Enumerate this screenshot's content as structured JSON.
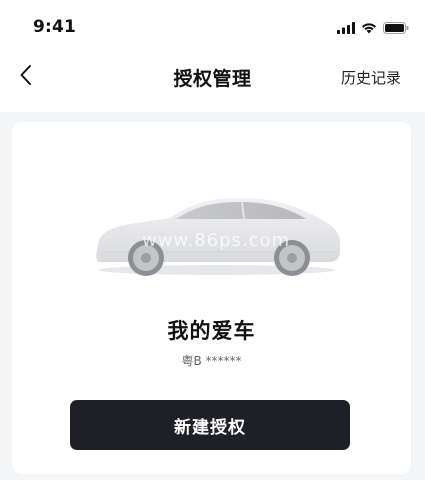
{
  "status_bar": {
    "time": "9:41",
    "icons": [
      "signal-icon",
      "wifi-icon",
      "battery-icon"
    ]
  },
  "nav": {
    "back_icon": "chevron-left-icon",
    "title": "授权管理",
    "history_label": "历史记录"
  },
  "card": {
    "car_image": "car-side-view",
    "watermark": "www.86ps.com",
    "car_name": "我的爱车",
    "plate": "粤B ******",
    "button_label": "新建授权"
  },
  "colors": {
    "page_background": "#f4f5f7",
    "card_background": "#ffffff",
    "button_background": "#1f1f28",
    "button_text": "#ffffff"
  }
}
